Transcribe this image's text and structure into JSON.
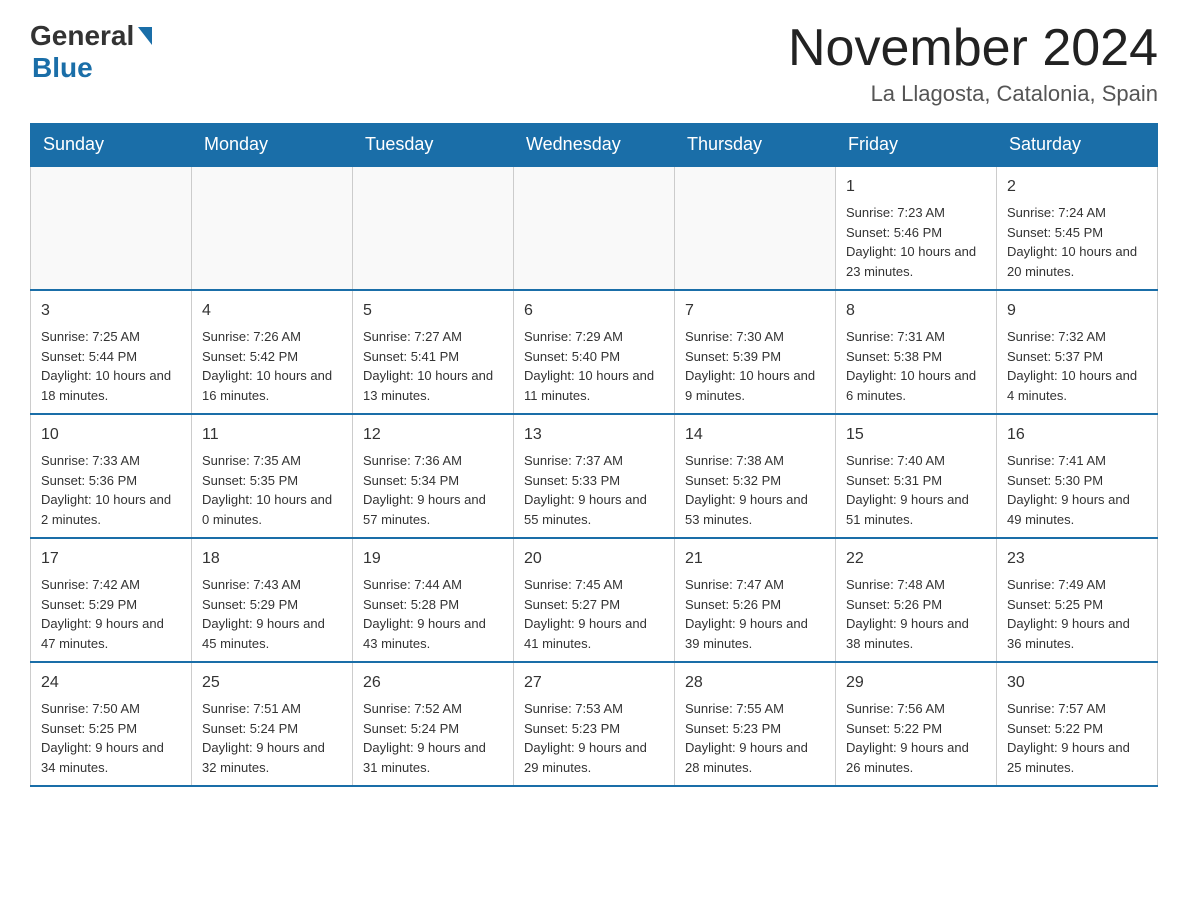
{
  "header": {
    "logo_general": "General",
    "logo_blue": "Blue",
    "month_year": "November 2024",
    "location": "La Llagosta, Catalonia, Spain"
  },
  "days_of_week": [
    "Sunday",
    "Monday",
    "Tuesday",
    "Wednesday",
    "Thursday",
    "Friday",
    "Saturday"
  ],
  "weeks": [
    [
      {
        "day": "",
        "sunrise": "",
        "sunset": "",
        "daylight": ""
      },
      {
        "day": "",
        "sunrise": "",
        "sunset": "",
        "daylight": ""
      },
      {
        "day": "",
        "sunrise": "",
        "sunset": "",
        "daylight": ""
      },
      {
        "day": "",
        "sunrise": "",
        "sunset": "",
        "daylight": ""
      },
      {
        "day": "",
        "sunrise": "",
        "sunset": "",
        "daylight": ""
      },
      {
        "day": "1",
        "sunrise": "Sunrise: 7:23 AM",
        "sunset": "Sunset: 5:46 PM",
        "daylight": "Daylight: 10 hours and 23 minutes."
      },
      {
        "day": "2",
        "sunrise": "Sunrise: 7:24 AM",
        "sunset": "Sunset: 5:45 PM",
        "daylight": "Daylight: 10 hours and 20 minutes."
      }
    ],
    [
      {
        "day": "3",
        "sunrise": "Sunrise: 7:25 AM",
        "sunset": "Sunset: 5:44 PM",
        "daylight": "Daylight: 10 hours and 18 minutes."
      },
      {
        "day": "4",
        "sunrise": "Sunrise: 7:26 AM",
        "sunset": "Sunset: 5:42 PM",
        "daylight": "Daylight: 10 hours and 16 minutes."
      },
      {
        "day": "5",
        "sunrise": "Sunrise: 7:27 AM",
        "sunset": "Sunset: 5:41 PM",
        "daylight": "Daylight: 10 hours and 13 minutes."
      },
      {
        "day": "6",
        "sunrise": "Sunrise: 7:29 AM",
        "sunset": "Sunset: 5:40 PM",
        "daylight": "Daylight: 10 hours and 11 minutes."
      },
      {
        "day": "7",
        "sunrise": "Sunrise: 7:30 AM",
        "sunset": "Sunset: 5:39 PM",
        "daylight": "Daylight: 10 hours and 9 minutes."
      },
      {
        "day": "8",
        "sunrise": "Sunrise: 7:31 AM",
        "sunset": "Sunset: 5:38 PM",
        "daylight": "Daylight: 10 hours and 6 minutes."
      },
      {
        "day": "9",
        "sunrise": "Sunrise: 7:32 AM",
        "sunset": "Sunset: 5:37 PM",
        "daylight": "Daylight: 10 hours and 4 minutes."
      }
    ],
    [
      {
        "day": "10",
        "sunrise": "Sunrise: 7:33 AM",
        "sunset": "Sunset: 5:36 PM",
        "daylight": "Daylight: 10 hours and 2 minutes."
      },
      {
        "day": "11",
        "sunrise": "Sunrise: 7:35 AM",
        "sunset": "Sunset: 5:35 PM",
        "daylight": "Daylight: 10 hours and 0 minutes."
      },
      {
        "day": "12",
        "sunrise": "Sunrise: 7:36 AM",
        "sunset": "Sunset: 5:34 PM",
        "daylight": "Daylight: 9 hours and 57 minutes."
      },
      {
        "day": "13",
        "sunrise": "Sunrise: 7:37 AM",
        "sunset": "Sunset: 5:33 PM",
        "daylight": "Daylight: 9 hours and 55 minutes."
      },
      {
        "day": "14",
        "sunrise": "Sunrise: 7:38 AM",
        "sunset": "Sunset: 5:32 PM",
        "daylight": "Daylight: 9 hours and 53 minutes."
      },
      {
        "day": "15",
        "sunrise": "Sunrise: 7:40 AM",
        "sunset": "Sunset: 5:31 PM",
        "daylight": "Daylight: 9 hours and 51 minutes."
      },
      {
        "day": "16",
        "sunrise": "Sunrise: 7:41 AM",
        "sunset": "Sunset: 5:30 PM",
        "daylight": "Daylight: 9 hours and 49 minutes."
      }
    ],
    [
      {
        "day": "17",
        "sunrise": "Sunrise: 7:42 AM",
        "sunset": "Sunset: 5:29 PM",
        "daylight": "Daylight: 9 hours and 47 minutes."
      },
      {
        "day": "18",
        "sunrise": "Sunrise: 7:43 AM",
        "sunset": "Sunset: 5:29 PM",
        "daylight": "Daylight: 9 hours and 45 minutes."
      },
      {
        "day": "19",
        "sunrise": "Sunrise: 7:44 AM",
        "sunset": "Sunset: 5:28 PM",
        "daylight": "Daylight: 9 hours and 43 minutes."
      },
      {
        "day": "20",
        "sunrise": "Sunrise: 7:45 AM",
        "sunset": "Sunset: 5:27 PM",
        "daylight": "Daylight: 9 hours and 41 minutes."
      },
      {
        "day": "21",
        "sunrise": "Sunrise: 7:47 AM",
        "sunset": "Sunset: 5:26 PM",
        "daylight": "Daylight: 9 hours and 39 minutes."
      },
      {
        "day": "22",
        "sunrise": "Sunrise: 7:48 AM",
        "sunset": "Sunset: 5:26 PM",
        "daylight": "Daylight: 9 hours and 38 minutes."
      },
      {
        "day": "23",
        "sunrise": "Sunrise: 7:49 AM",
        "sunset": "Sunset: 5:25 PM",
        "daylight": "Daylight: 9 hours and 36 minutes."
      }
    ],
    [
      {
        "day": "24",
        "sunrise": "Sunrise: 7:50 AM",
        "sunset": "Sunset: 5:25 PM",
        "daylight": "Daylight: 9 hours and 34 minutes."
      },
      {
        "day": "25",
        "sunrise": "Sunrise: 7:51 AM",
        "sunset": "Sunset: 5:24 PM",
        "daylight": "Daylight: 9 hours and 32 minutes."
      },
      {
        "day": "26",
        "sunrise": "Sunrise: 7:52 AM",
        "sunset": "Sunset: 5:24 PM",
        "daylight": "Daylight: 9 hours and 31 minutes."
      },
      {
        "day": "27",
        "sunrise": "Sunrise: 7:53 AM",
        "sunset": "Sunset: 5:23 PM",
        "daylight": "Daylight: 9 hours and 29 minutes."
      },
      {
        "day": "28",
        "sunrise": "Sunrise: 7:55 AM",
        "sunset": "Sunset: 5:23 PM",
        "daylight": "Daylight: 9 hours and 28 minutes."
      },
      {
        "day": "29",
        "sunrise": "Sunrise: 7:56 AM",
        "sunset": "Sunset: 5:22 PM",
        "daylight": "Daylight: 9 hours and 26 minutes."
      },
      {
        "day": "30",
        "sunrise": "Sunrise: 7:57 AM",
        "sunset": "Sunset: 5:22 PM",
        "daylight": "Daylight: 9 hours and 25 minutes."
      }
    ]
  ]
}
